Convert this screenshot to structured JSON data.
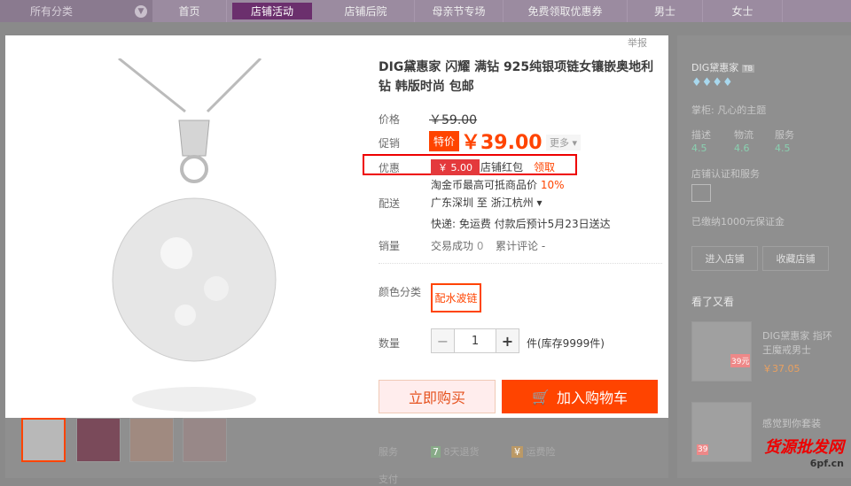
{
  "nav": {
    "category": "所有分类",
    "items": [
      "首页",
      "店铺活动",
      "店铺后院",
      "母亲节专场",
      "免费领取优惠券",
      "男士",
      "女士"
    ]
  },
  "product": {
    "title": "DIG黛惠家 闪耀 满钻 925纯银项链女镶嵌奥地利钻 韩版时尚 包邮",
    "report": "举报",
    "price_label": "价格",
    "original_price": "￥59.00",
    "promo_label": "促销",
    "promo_badge": "特价",
    "promo_price": "￥39.00",
    "more": "更多",
    "coupon_label": "优惠",
    "coupon_value": "￥ 5.00",
    "coupon_name": "店铺红包",
    "coupon_action": "领取",
    "taobao_coin": "淘金币最高可抵商品价",
    "taobao_pct": "10%",
    "ship_label": "配送",
    "ship_from": "广东深圳",
    "ship_to_word": "至",
    "ship_to": "浙江杭州",
    "ship_info": "快递: 免运费 付款后预计5月23日送达",
    "sales_label": "销量",
    "sales_trade": "交易成功",
    "sales_count": "0",
    "sales_review": "累计评论",
    "color_label": "颜色分类",
    "color_option": "配水波链",
    "qty_label": "数量",
    "qty_value": "1",
    "stock": "件(库存9999件)",
    "buy_now": "立即购买",
    "add_cart": "加入购物车"
  },
  "shop": {
    "name": "DIG黛惠家",
    "tag": "TB",
    "owner": "掌柜: 凡心的主题",
    "ratings": [
      {
        "label": "描述",
        "val": "4.5"
      },
      {
        "label": "物流",
        "val": "4.6"
      },
      {
        "label": "服务",
        "val": "4.5"
      }
    ],
    "cert": "店铺认证和服务",
    "deposit": "已缴纳1000元保证金",
    "enter": "进入店铺",
    "fav": "收藏店铺",
    "seen_title": "看了又看",
    "rec1_name": "DIG黛惠家 指环王魔戒男士",
    "rec1_price": "￥37.05",
    "rec1_tag": "39元",
    "rec2_name": "感觉到你套装",
    "rec2_tag": "39"
  },
  "service": {
    "label": "服务",
    "return": "8天退货",
    "insurance": "运费险",
    "label2": "支付"
  },
  "watermark": {
    "line1": "货源批发网",
    "line2": "6pf.cn"
  }
}
